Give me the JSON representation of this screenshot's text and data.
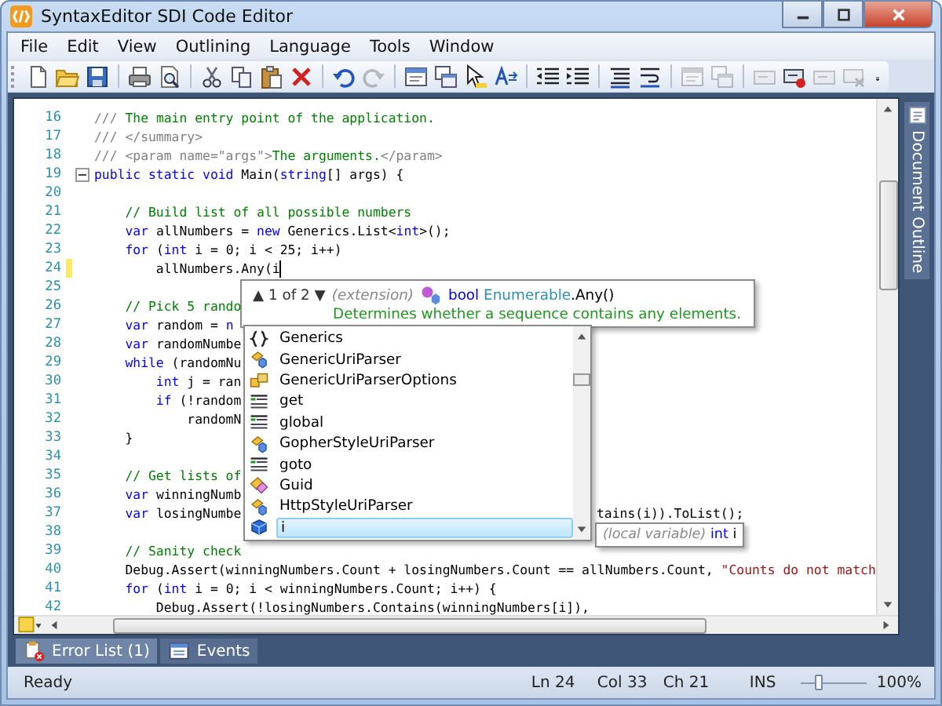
{
  "window": {
    "title": "SyntaxEditor SDI Code Editor"
  },
  "menu": [
    "File",
    "Edit",
    "View",
    "Outlining",
    "Language",
    "Tools",
    "Window"
  ],
  "toolbar": [
    {
      "kind": "new",
      "disabled": false
    },
    {
      "kind": "open",
      "disabled": false
    },
    {
      "kind": "save",
      "disabled": false
    },
    {
      "kind": "separator"
    },
    {
      "kind": "print",
      "disabled": false
    },
    {
      "kind": "preview",
      "disabled": false
    },
    {
      "kind": "separator"
    },
    {
      "kind": "cut",
      "disabled": false
    },
    {
      "kind": "copy",
      "disabled": false
    },
    {
      "kind": "paste",
      "disabled": false
    },
    {
      "kind": "delete",
      "disabled": false
    },
    {
      "kind": "separator"
    },
    {
      "kind": "undo",
      "disabled": false
    },
    {
      "kind": "redo",
      "disabled": true
    },
    {
      "kind": "separator"
    },
    {
      "kind": "window",
      "disabled": false
    },
    {
      "kind": "windows",
      "disabled": false
    },
    {
      "kind": "cursor",
      "disabled": false
    },
    {
      "kind": "size",
      "disabled": false
    },
    {
      "kind": "separator"
    },
    {
      "kind": "outdent",
      "disabled": false
    },
    {
      "kind": "indent",
      "disabled": false
    },
    {
      "kind": "separator"
    },
    {
      "kind": "lines",
      "disabled": false
    },
    {
      "kind": "wrap",
      "disabled": false
    },
    {
      "kind": "separator"
    },
    {
      "kind": "window",
      "disabled": true
    },
    {
      "kind": "windows",
      "disabled": true
    },
    {
      "kind": "separator"
    },
    {
      "kind": "macro",
      "disabled": true
    },
    {
      "kind": "record",
      "disabled": false
    },
    {
      "kind": "macro",
      "disabled": true
    },
    {
      "kind": "cancel",
      "disabled": true
    },
    {
      "kind": "overflow",
      "disabled": false
    }
  ],
  "editor": {
    "lines": [
      {
        "n": "16",
        "code": [
          {
            "kind": "doc",
            "text": "///"
          },
          {
            "kind": "comment",
            "text": " The main entry point of the application."
          }
        ]
      },
      {
        "n": "17",
        "code": [
          {
            "kind": "doc",
            "text": "/// </summary>"
          }
        ]
      },
      {
        "n": "18",
        "code": [
          {
            "kind": "doc",
            "text": "/// <param name=\"args\">"
          },
          {
            "kind": "comment",
            "text": "The arguments."
          },
          {
            "kind": "doc",
            "text": "</param>"
          }
        ]
      },
      {
        "n": "19",
        "fold_open": true,
        "code": [
          {
            "kind": "kw",
            "text": "public static void"
          },
          {
            "kind": "plain",
            "text": " Main("
          },
          {
            "kind": "kw",
            "text": "string"
          },
          {
            "kind": "plain",
            "text": "[] args) {"
          }
        ]
      },
      {
        "n": "20"
      },
      {
        "n": "21",
        "code": [
          {
            "kind": "comment",
            "text": "    // Build list of all possible numbers"
          }
        ]
      },
      {
        "n": "22",
        "code": [
          {
            "kind": "kw",
            "text": "    var"
          },
          {
            "kind": "plain",
            "text": " allNumbers = "
          },
          {
            "kind": "kw",
            "text": "new"
          },
          {
            "kind": "plain",
            "text": " Generics.List<"
          },
          {
            "kind": "kw",
            "text": "int"
          },
          {
            "kind": "plain",
            "text": ">();"
          }
        ]
      },
      {
        "n": "23",
        "code": [
          {
            "kind": "kw",
            "text": "    for"
          },
          {
            "kind": "plain",
            "text": " ("
          },
          {
            "kind": "kw",
            "text": "int"
          },
          {
            "kind": "plain",
            "text": " i = 0; i < 25; i++)"
          }
        ]
      },
      {
        "n": "24",
        "changed": true,
        "caret": true,
        "code": [
          {
            "kind": "plain",
            "text": "        allNumbers.Any(i"
          }
        ]
      },
      {
        "n": "25"
      },
      {
        "n": "26",
        "code": [
          {
            "kind": "comment",
            "text": "    // Pick 5 rando"
          }
        ]
      },
      {
        "n": "27",
        "code": [
          {
            "kind": "kw",
            "text": "    var"
          },
          {
            "kind": "plain",
            "text": " random = "
          },
          {
            "kind": "kw",
            "text": "n"
          }
        ]
      },
      {
        "n": "28",
        "code": [
          {
            "kind": "kw",
            "text": "    var"
          },
          {
            "kind": "plain",
            "text": " randomNumbe"
          }
        ]
      },
      {
        "n": "29",
        "code": [
          {
            "kind": "kw",
            "text": "    while"
          },
          {
            "kind": "plain",
            "text": " (randomNu"
          }
        ]
      },
      {
        "n": "30",
        "code": [
          {
            "kind": "kw",
            "text": "        int"
          },
          {
            "kind": "plain",
            "text": " j = ran"
          }
        ]
      },
      {
        "n": "31",
        "code": [
          {
            "kind": "kw",
            "text": "        if"
          },
          {
            "kind": "plain",
            "text": " (!random"
          }
        ]
      },
      {
        "n": "32",
        "code": [
          {
            "kind": "plain",
            "text": "            randomN"
          }
        ]
      },
      {
        "n": "33",
        "code": [
          {
            "kind": "plain",
            "text": "    }"
          }
        ]
      },
      {
        "n": "34"
      },
      {
        "n": "35",
        "code": [
          {
            "kind": "comment",
            "text": "    // Get lists of"
          }
        ]
      },
      {
        "n": "36",
        "code": [
          {
            "kind": "kw",
            "text": "    var"
          },
          {
            "kind": "plain",
            "text": " winningNumb"
          }
        ]
      },
      {
        "n": "37",
        "code": [
          {
            "kind": "kw",
            "text": "    var"
          },
          {
            "kind": "plain",
            "text": " losingNumbe"
          }
        ],
        "after_popup": "tains(i)).ToList();"
      },
      {
        "n": "38"
      },
      {
        "n": "39",
        "code": [
          {
            "kind": "comment",
            "text": "    // Sanity check"
          }
        ]
      },
      {
        "n": "40",
        "code": [
          {
            "kind": "plain",
            "text": "    Debug.Assert(winningNumbers.Count + losingNumbers.Count == allNumbers.Count, "
          },
          {
            "kind": "string",
            "text": "\"Counts do not match"
          }
        ]
      },
      {
        "n": "41",
        "code": [
          {
            "kind": "kw",
            "text": "    for"
          },
          {
            "kind": "plain",
            "text": " ("
          },
          {
            "kind": "kw",
            "text": "int"
          },
          {
            "kind": "plain",
            "text": " i = 0; i < winningNumbers.Count; i++) {"
          }
        ]
      },
      {
        "n": "42",
        "code": [
          {
            "kind": "plain",
            "text": "        Debug.Assert(!losingNumbers.Contains(winningNumbers[i]),"
          }
        ]
      }
    ]
  },
  "signature_tooltip": {
    "pager": "▲ 1 of 2 ▼",
    "prefix": "(extension)",
    "return_type": "bool",
    "type_name": "Enumerable",
    "member": ".Any()",
    "description": "Determines whether a sequence contains any elements."
  },
  "completion": {
    "items": [
      {
        "label": "Generics",
        "kind": "namespace",
        "selected": false
      },
      {
        "label": "GenericUriParser",
        "kind": "class",
        "selected": false
      },
      {
        "label": "GenericUriParserOptions",
        "kind": "enum",
        "selected": false
      },
      {
        "label": "get",
        "kind": "keyword",
        "selected": false
      },
      {
        "label": "global",
        "kind": "keyword",
        "selected": false
      },
      {
        "label": "GopherStyleUriParser",
        "kind": "class",
        "selected": false
      },
      {
        "label": "goto",
        "kind": "keyword",
        "selected": false
      },
      {
        "label": "Guid",
        "kind": "struct",
        "selected": false
      },
      {
        "label": "HttpStyleUriParser",
        "kind": "class",
        "selected": false
      },
      {
        "label": "i",
        "kind": "local",
        "selected": true
      }
    ]
  },
  "item_tooltip": {
    "prefix": "(local variable)",
    "type": "int",
    "name": "i"
  },
  "side_tab": {
    "label": "Document Outline"
  },
  "bottom_tabs": [
    {
      "label": "Error List (1)",
      "kind": "errors",
      "selected": true
    },
    {
      "label": "Events",
      "kind": "events",
      "selected": false
    }
  ],
  "status_bar": {
    "message": "Ready",
    "line": "Ln 24",
    "column": "Col 33",
    "char": "Ch 21",
    "mode": "INS",
    "zoom": {
      "level": 0.25,
      "reading": "100%"
    }
  }
}
